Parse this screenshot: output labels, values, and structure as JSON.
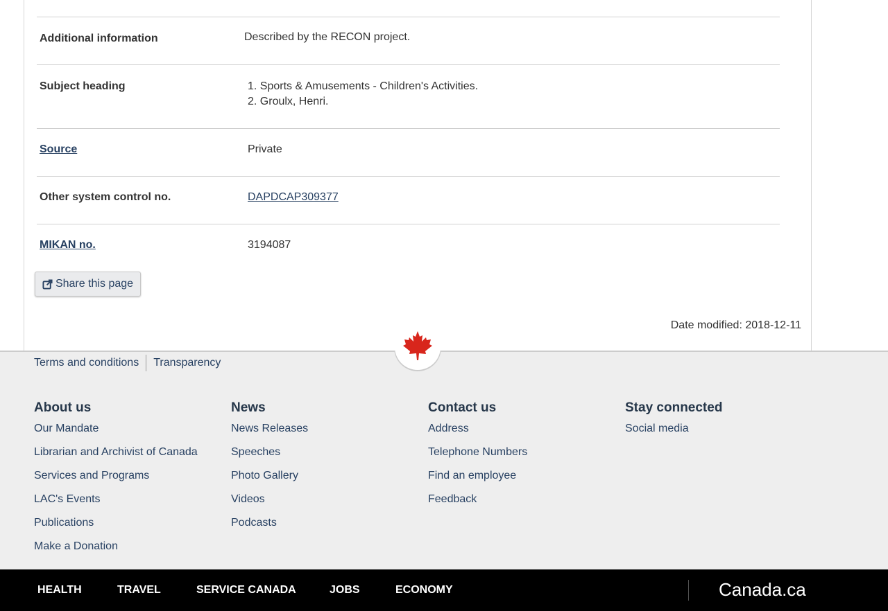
{
  "details": {
    "additional_info": {
      "label": "Additional information",
      "value": "Described by the RECON project."
    },
    "subject_heading": {
      "label": "Subject heading",
      "items": [
        "1. Sports & Amusements - Children's Activities.",
        "2. Groulx, Henri."
      ]
    },
    "source": {
      "label": "Source",
      "value": "Private"
    },
    "other_control": {
      "label": "Other system control no.",
      "value": "DAPDCAP309377"
    },
    "mikan": {
      "label": "MIKAN no.",
      "value": "3194087"
    }
  },
  "share_label": "Share this page",
  "date_modified": "Date modified: 2018-12-11",
  "footer": {
    "terms": "Terms and conditions",
    "transparency": "Transparency",
    "columns": [
      {
        "title": "About us",
        "items": [
          "Our Mandate",
          "Librarian and Archivist of Canada",
          "Services and Programs",
          "LAC's Events",
          "Publications",
          "Make a Donation"
        ]
      },
      {
        "title": "News",
        "items": [
          "News Releases",
          "Speeches",
          "Photo Gallery",
          "Videos",
          "Podcasts"
        ]
      },
      {
        "title": "Contact us",
        "items": [
          "Address",
          "Telephone Numbers",
          "Find an employee",
          "Feedback"
        ]
      },
      {
        "title": "Stay connected",
        "items": [
          "Social media"
        ]
      }
    ]
  },
  "bottombar": {
    "items": [
      "HEALTH",
      "TRAVEL",
      "SERVICE CANADA",
      "JOBS",
      "ECONOMY"
    ],
    "canada": "Canada.ca"
  },
  "colors": {
    "link": "#284162",
    "heading": "#26374a",
    "maple_leaf": "#d8261c"
  }
}
